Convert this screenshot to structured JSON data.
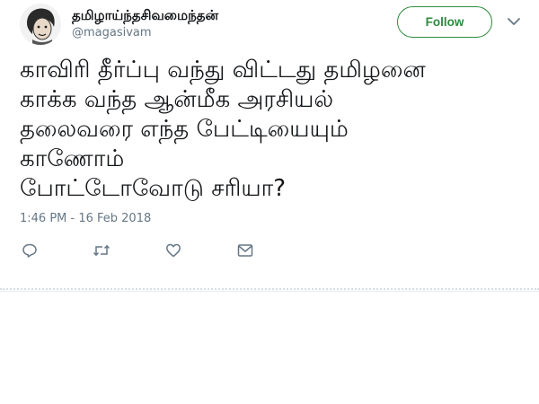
{
  "tweet": {
    "author": {
      "display_name": "தமிழாய்ந்தசிவமைந்தன்",
      "handle": "@magasivam",
      "avatar_icon": "avatar-cartoon-face"
    },
    "follow_label": "Follow",
    "menu_icon": "chevron-down-icon",
    "text_lines": [
      "காவிரி தீர்ப்பு வந்து விட்டது தமிழனை",
      "காக்க வந்த ஆன்மீக அரசியல்",
      "தலைவரை எந்த பேட்டியையும்",
      "காணோம்",
      "போட்டோவோடு சரியா?"
    ],
    "timestamp": "1:46 PM - 16 Feb 2018",
    "actions": [
      "reply-icon",
      "retweet-icon",
      "like-icon",
      "message-icon"
    ]
  },
  "colors": {
    "accent": "#2e8b3e",
    "text_primary": "#14171a",
    "text_secondary": "#657786",
    "divider": "#e6ecf0"
  }
}
